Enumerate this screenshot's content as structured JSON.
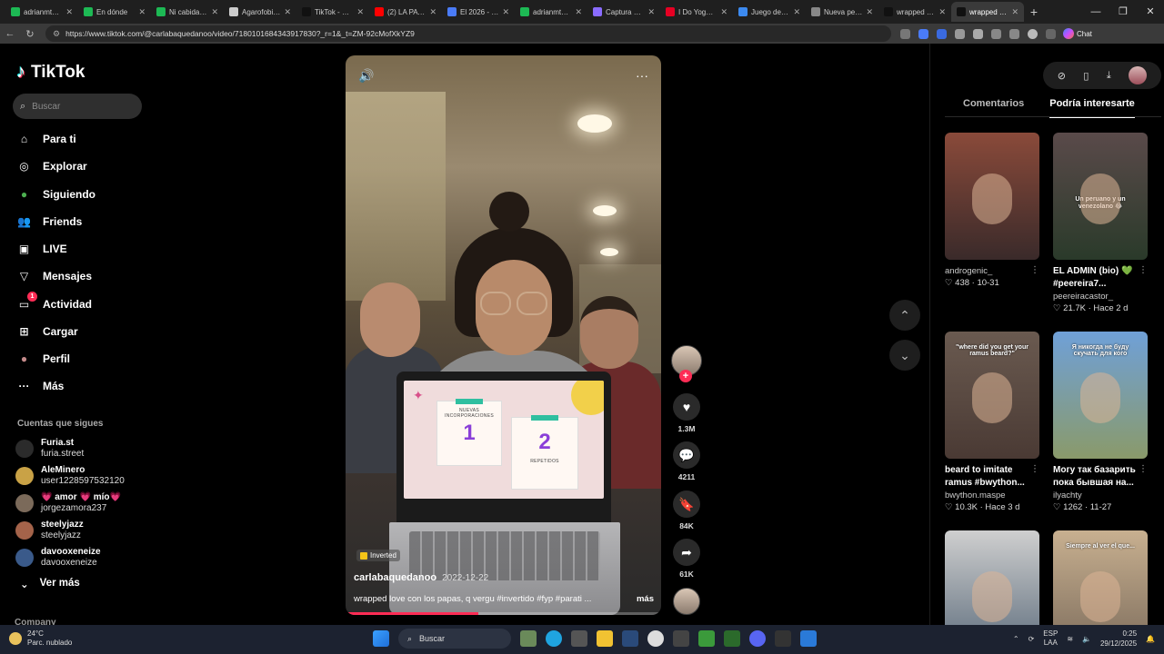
{
  "browser": {
    "tabs": [
      {
        "label": "adrianmts St",
        "color": "#1db954"
      },
      {
        "label": "En dónde",
        "color": "#1db954"
      },
      {
        "label": "Ni cabida co",
        "color": "#1db954"
      },
      {
        "label": "Agarofobia d",
        "color": "#cccccc"
      },
      {
        "label": "TikTok - Mak",
        "color": "#111111"
      },
      {
        "label": "(2) LA PATRU",
        "color": "#ff0000"
      },
      {
        "label": "El 2026 - Coll",
        "color": "#4a7bf7"
      },
      {
        "label": "adrianmts St",
        "color": "#1db954"
      },
      {
        "label": "Captura de p",
        "color": "#8a6cff"
      },
      {
        "label": "I Do Yoga to",
        "color": "#e60023"
      },
      {
        "label": "Juego de ¡Ba",
        "color": "#3c8af0"
      },
      {
        "label": "Nueva pestañ",
        "color": "#888888"
      },
      {
        "label": "wrapped lov",
        "color": "#111111"
      },
      {
        "label": "wrapped love",
        "color": "#111111",
        "active": true
      }
    ],
    "new_tab": "+",
    "url": "https://www.tiktok.com/@carlabaquedanoo/video/7180101684343917830?_r=1&_t=ZM-92cMofXkYZ9",
    "chat_label": "Chat"
  },
  "sidebar": {
    "logo_text": "TikTok",
    "search_placeholder": "Buscar",
    "nav": [
      {
        "label": "Para ti",
        "icon": "home-icon"
      },
      {
        "label": "Explorar",
        "icon": "compass-icon"
      },
      {
        "label": "Siguiendo",
        "icon": "following-avatar-icon"
      },
      {
        "label": "Friends",
        "icon": "friends-icon"
      },
      {
        "label": "LIVE",
        "icon": "live-icon"
      },
      {
        "label": "Mensajes",
        "icon": "messages-icon"
      },
      {
        "label": "Actividad",
        "icon": "activity-icon",
        "badge": "1"
      },
      {
        "label": "Cargar",
        "icon": "upload-icon"
      },
      {
        "label": "Perfil",
        "icon": "profile-avatar-icon"
      },
      {
        "label": "Más",
        "icon": "more-icon"
      }
    ],
    "following_title": "Cuentas que sigues",
    "following": [
      {
        "display": "Furia.st",
        "user": "furia.street",
        "color": "#2b2b2b"
      },
      {
        "display": "AleMinero",
        "user": "user1228597532120",
        "color": "#c9a246"
      },
      {
        "display": "💗 amor 💗 mío💗",
        "user": "jorgezamora237",
        "color": "#7b6a5a"
      },
      {
        "display": "steelyjazz",
        "user": "steelyjazz",
        "color": "#a4634a"
      },
      {
        "display": "davooxeneize",
        "user": "davooxeneize",
        "color": "#3a5a8a"
      }
    ],
    "see_more": "Ver más",
    "company": "Company"
  },
  "video": {
    "effect": "Inverted",
    "author": "carlabaquedanoo",
    "date": "2022-12-22",
    "description": "wrapped love con los papas, q vergu #invertido #fyp #parati ...",
    "more": "más",
    "progress": 0.42,
    "screen_card_1_title": "NUEVAS INCORPORACIONES",
    "screen_card_1_value": "1",
    "screen_card_2_value": "2",
    "screen_card_2_title": "REPETIDOS"
  },
  "actions": {
    "likes": "1.3M",
    "comments": "4211",
    "saves": "84K",
    "shares": "61K"
  },
  "right_panel": {
    "tabs": [
      "Comentarios",
      "Podría interesarte"
    ],
    "active_tab": "Podría interesarte",
    "recs": [
      {
        "title": "",
        "user": "androgenic_",
        "stats": "♡ 438 · 10-31",
        "bg": "linear-gradient(180deg,#8a4a3a,#3a2a2a)",
        "caption": ""
      },
      {
        "title": "EL ADMIN (bio) 💚 #peereira7...",
        "user": "peereiracastor_",
        "stats": "♡ 21.7K · Hace 2 d",
        "bg": "linear-gradient(180deg,#5a4a4a,#2a3a2a)",
        "caption": "Un peruano y un venezolano 😂"
      },
      {
        "title": "beard to imitate ramus #bwython...",
        "user": "bwython.maspe",
        "stats": "♡ 10.3K · Hace 3 d",
        "bg": "linear-gradient(180deg,#6a5a50,#4a3a34)",
        "caption": "\"where did you get your ramus beard?\""
      },
      {
        "title": "Могу так базарить пока бывшая на...",
        "user": "ilyachty",
        "stats": "♡ 1262 · 11-27",
        "bg": "linear-gradient(180deg,#6fa0d8,#8a9a6a)",
        "caption": "Я никогда не буду скучать для кого"
      },
      {
        "title": "",
        "user": "",
        "stats": "",
        "bg": "linear-gradient(180deg,#cfcfcf,#5a6a7a)",
        "caption": ""
      },
      {
        "title": "",
        "user": "",
        "stats": "",
        "bg": "linear-gradient(180deg,#c8b090,#7a6a5a)",
        "caption": "Siempre al ver el que..."
      }
    ]
  },
  "taskbar": {
    "temp": "24°C",
    "weather": "Parc. nublado",
    "search": "Buscar",
    "lang_top": "ESP",
    "lang_bottom": "LAA",
    "time": "0:25",
    "date": "29/12/2025"
  }
}
